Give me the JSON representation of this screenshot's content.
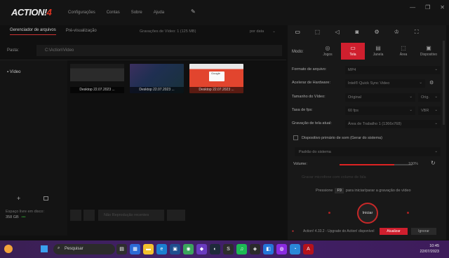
{
  "app": {
    "logo_text": "ACTION!",
    "logo_number": "4",
    "menu": [
      "Configurações",
      "Contas",
      "Sobre",
      "Ajuda"
    ]
  },
  "window_controls": {
    "minimize": "—",
    "restore": "❐",
    "close": "✕"
  },
  "left": {
    "tabs": [
      "Gerenciador de arquivos",
      "Pré-visualização"
    ],
    "summary": "Gravações de Vídeo: 1 (125 MB)",
    "sort": "por data",
    "path_label": "Pasta:",
    "path_value": "C:\\Action\\Video",
    "sidebar_item": "Vídeo",
    "free_space_label": "Espaço livre em disco:",
    "free_space_value": "358 GB",
    "free_space_dots": "•••",
    "thumbnails": [
      {
        "caption": "Desktop 22.07.2023 ..."
      },
      {
        "caption": "Desktop 22.07.2023 ..."
      },
      {
        "caption": "Desktop 22.07.2023 ..."
      }
    ],
    "thumb3_text": "Google",
    "playbar_text": "Não Reprodução recentes"
  },
  "right": {
    "tab_icons": [
      "monitor-icon",
      "video-card-icon",
      "speaker-icon",
      "camera-icon",
      "gear-icon",
      "trophy-icon"
    ],
    "mode_label": "Modo:",
    "modes": [
      {
        "label": "Jogos",
        "icon": "gamepad-icon",
        "selected": false
      },
      {
        "label": "Tela",
        "icon": "screen-icon",
        "selected": true
      },
      {
        "label": "Janela",
        "icon": "window-icon",
        "selected": false
      },
      {
        "label": "Área",
        "icon": "area-icon",
        "selected": false
      },
      {
        "label": "Dispositivo",
        "icon": "device-icon",
        "selected": false
      }
    ],
    "fields": [
      {
        "label": "Formato de arquivo:",
        "value": "MP4"
      },
      {
        "label": "Acelerar de Hardware:",
        "value": "Intel® Quick Sync Video"
      },
      {
        "label": "Tamanho do Vídeo:",
        "value": "Original",
        "extra": "Orig."
      },
      {
        "label": "Taxa de fps:",
        "value": "60 fps",
        "extra": "VBR"
      },
      {
        "label": "Gravação de tela atual:",
        "value": "Área de Trabalho 1 (1366x768)"
      }
    ],
    "mic_checkbox": "Dispositivo primário de som (Gerar do sistema)",
    "mic_select": "Padrão do sistema",
    "volume_label": "Volume:",
    "volume_pct": "100%",
    "volume_level": 0.75,
    "faded_text": "Gravar microfone com volume de fala",
    "hotkey_prefix": "Pressione",
    "hotkey_key": "F9",
    "hotkey_suffix": "para iniciar/parar a gravação de vídeo",
    "record_button": "Iniciar",
    "status_warning": "Action! 4.33.2 - Upgrade do Action! disponível",
    "status_primary": "Atualizar",
    "status_secondary": "Ignorar",
    "accent_color": "#cf1f2e"
  },
  "taskbar": {
    "search_placeholder": "Pesquisar",
    "time": "10:45",
    "date": "22/07/2023"
  }
}
